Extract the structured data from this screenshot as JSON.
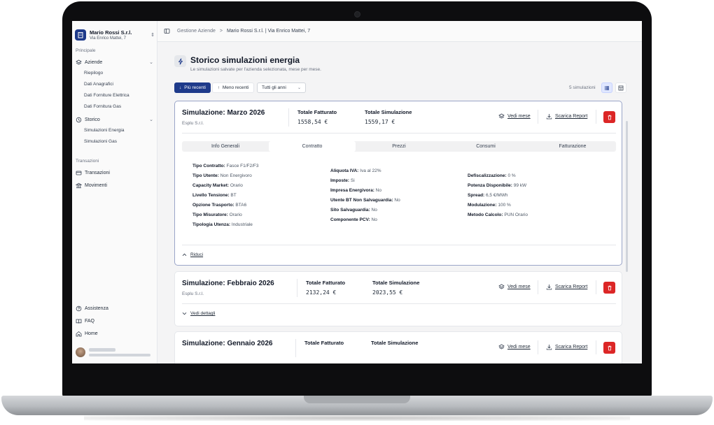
{
  "company": {
    "name": "Mario Rossi S.r.l.",
    "address": "Via Enrico Mattei, 7"
  },
  "sidebar": {
    "section_principale": "Principale",
    "aziende_label": "Aziende",
    "aziende_sub": [
      "Riepilogo",
      "Dati Anagrafici",
      "Dati Forniture Elettrica",
      "Dati Fornitura Gas"
    ],
    "storico_label": "Storico",
    "storico_sub": [
      "Simulazioni Energia",
      "Simulazioni Gas"
    ],
    "section_transazioni": "Transazioni",
    "transazioni_label": "Transazioni",
    "movimenti_label": "Movimenti",
    "assistenza_label": "Assistenza",
    "faq_label": "FAQ",
    "home_label": "Home"
  },
  "breadcrumb": {
    "root": "Gestione Aziende",
    "separator": ">",
    "current": "Mario Rossi S.r.l. | Via Enrico Mattei, 7"
  },
  "page": {
    "title": "Storico simulazioni energia",
    "subtitle": "Le simulazioni salvate per l'azienda selezionata, mese per mese."
  },
  "toolbar": {
    "sort_recent": "Più recenti",
    "sort_old": "Meno recenti",
    "year_select": "Tutti gli anni",
    "count": "5 simulazioni"
  },
  "labels": {
    "totale_fatturato": "Totale Fatturato",
    "totale_simulazione": "Totale Simulazione",
    "vedi_mese": "Vedi mese",
    "scarica_report": "Scarica Report",
    "riduci": "Riduci",
    "vedi_dettagli": "Vedi dettagli"
  },
  "simulations": [
    {
      "title": "Simulazione: Marzo 2026",
      "org": "Esplu S.r.l.",
      "fatturato": "1558,54 €",
      "simulazione": "1559,17 €"
    },
    {
      "title": "Simulazione: Febbraio 2026",
      "org": "Esplu S.r.l.",
      "fatturato": "2132,24 €",
      "simulazione": "2023,55 €"
    },
    {
      "title": "Simulazione: Gennaio 2026",
      "org": "",
      "fatturato": "",
      "simulazione": ""
    }
  ],
  "tabs": [
    "Info Generali",
    "Contratto",
    "Prezzi",
    "Consumi",
    "Fatturazione"
  ],
  "details": {
    "col1": [
      {
        "label": "Tipo Contratto:",
        "value": "Fasce F1/F2/F3"
      },
      {
        "label": "Tipo Utente:",
        "value": "Non Energivoro"
      },
      {
        "label": "Capacity Market:",
        "value": "Orario"
      },
      {
        "label": "Livello Tensione:",
        "value": "BT"
      },
      {
        "label": "Opzione Trasporto:",
        "value": "BTA6"
      },
      {
        "label": "Tipo Misuratore:",
        "value": "Orario"
      },
      {
        "label": "Tipologia Utenza:",
        "value": "Industriale"
      }
    ],
    "col2": [
      {
        "label": "Aliquota IVA:",
        "value": "Iva al 22%"
      },
      {
        "label": "Imposte:",
        "value": "Si"
      },
      {
        "label": "Impresa Energivora:",
        "value": "No"
      },
      {
        "label": "Utente BT Non Salvaguardia:",
        "value": "No"
      },
      {
        "label": "Sito Salvaguardia:",
        "value": "No"
      },
      {
        "label": "Componente PCV:",
        "value": "No"
      }
    ],
    "col3": [
      {
        "label": "Defiscalizzazione:",
        "value": "0 %"
      },
      {
        "label": "Potenza Disponibile:",
        "value": "99 kW"
      },
      {
        "label": "Spread:",
        "value": "6,5 €/MWh"
      },
      {
        "label": "Modulazione:",
        "value": "100 %"
      },
      {
        "label": "Metodo Calcolo:",
        "value": "PUN Orario"
      }
    ]
  },
  "colors": {
    "primary": "#1e3a8a",
    "danger": "#dc2626"
  }
}
